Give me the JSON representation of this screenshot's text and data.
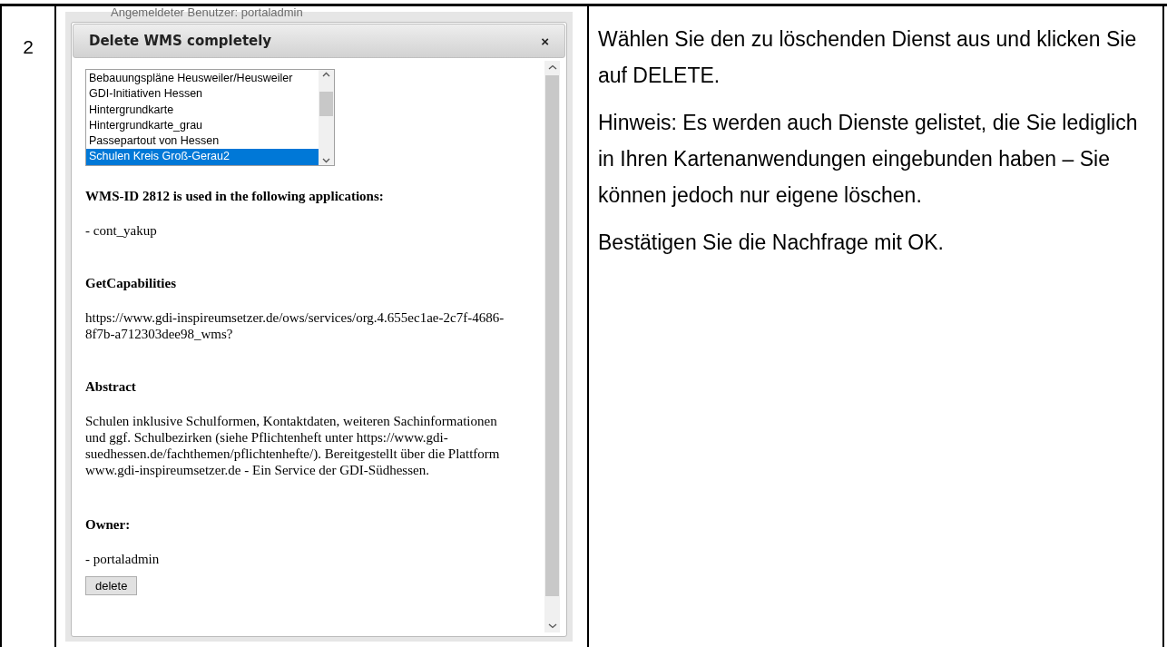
{
  "step_number": "2",
  "background_header": {
    "text": "Angemeldeter Benutzer: portaladmin"
  },
  "dialog": {
    "title": "Delete WMS completely",
    "close": "×",
    "services": [
      {
        "label": "Bebauungspläne Heusweiler/Heusweiler",
        "selected": false
      },
      {
        "label": "GDI-Initiativen Hessen",
        "selected": false
      },
      {
        "label": "Hintergrundkarte",
        "selected": false
      },
      {
        "label": "Hintergrundkarte_grau",
        "selected": false
      },
      {
        "label": "Passepartout von Hessen",
        "selected": false
      },
      {
        "label": "Schulen Kreis Groß-Gerau2",
        "selected": true
      }
    ],
    "sections": [
      {
        "heading": "WMS-ID 2812 is used in the following applications:",
        "body": "- cont_yakup"
      },
      {
        "heading": "GetCapabilities",
        "body": "https://www.gdi-inspireumsetzer.de/ows/services/org.4.655ec1ae-2c7f-4686-8f7b-a712303dee98_wms?"
      },
      {
        "heading": "Abstract",
        "body": "Schulen inklusive Schulformen, Kontaktdaten, weiteren Sachinformationen und ggf. Schulbezirken (siehe Pflichtenheft unter https://www.gdi-suedhessen.de/fachthemen/pflichtenhefte/). Bereitgestellt über die Plattform www.gdi-inspireumsetzer.de - Ein Service der GDI-Südhessen."
      },
      {
        "heading": "Owner:",
        "body": "- portaladmin"
      }
    ],
    "button": "delete"
  },
  "instructions": [
    "Wählen Sie den zu löschenden Dienst aus und klicken Sie auf DELETE.",
    "Hinweis: Es werden auch Dienste gelistet, die Sie lediglich in Ihren Kartenanwendungen eingebunden haben – Sie können jedoch nur eigene löschen.",
    "Bestätigen Sie die Nachfrage mit OK."
  ]
}
